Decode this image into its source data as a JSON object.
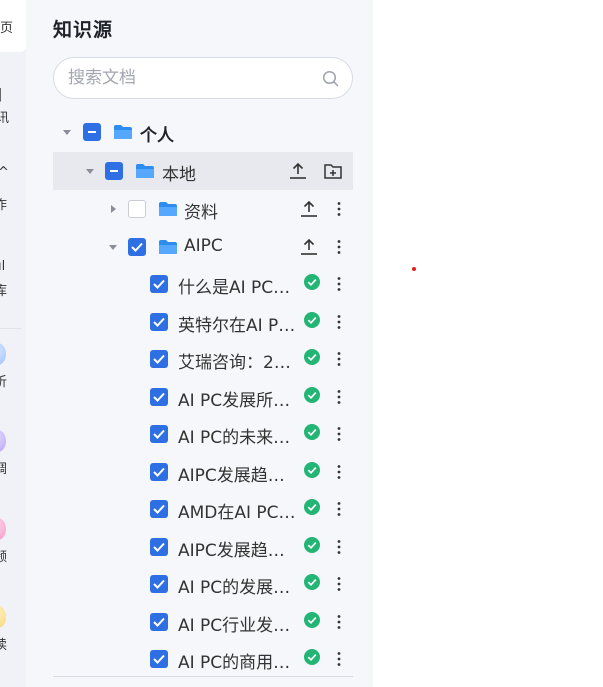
{
  "rail": {
    "glyphs": [
      "页",
      "|",
      "讯",
      "^",
      "作",
      "ıl",
      "库",
      "析",
      "调",
      "频",
      "读"
    ]
  },
  "panel": {
    "title": "知识源",
    "search": {
      "placeholder": "搜索文档",
      "value": ""
    },
    "tree": {
      "root": {
        "label": "个人",
        "checked": "partial"
      },
      "local": {
        "label": "本地",
        "checked": "partial"
      },
      "folders": [
        {
          "label": "资料",
          "checked": false,
          "expanded": false
        },
        {
          "label": "AIPC",
          "checked": true,
          "expanded": true
        }
      ],
      "files": [
        {
          "label": "什么是AI PC…",
          "status": "done"
        },
        {
          "label": "英特尔在AI P…",
          "status": "done"
        },
        {
          "label": "艾瑞咨询：20…",
          "status": "done"
        },
        {
          "label": "AI PC发展所…",
          "status": "done"
        },
        {
          "label": "AI PC的未来…",
          "status": "done"
        },
        {
          "label": "AIPC发展趋…",
          "status": "done"
        },
        {
          "label": "AMD在AI PC…",
          "status": "done"
        },
        {
          "label": "AIPC发展趋…",
          "status": "done"
        },
        {
          "label": "AI PC的发展…",
          "status": "done"
        },
        {
          "label": "AI PC行业发…",
          "status": "done"
        },
        {
          "label": "AI PC的商用…",
          "status": "done"
        }
      ]
    }
  },
  "colors": {
    "accent": "#2f6fe4",
    "folder": "#2d8cf0",
    "success": "#22b573",
    "panel_bg": "#f6f7fb",
    "highlight_bg": "#e8e9ef"
  }
}
